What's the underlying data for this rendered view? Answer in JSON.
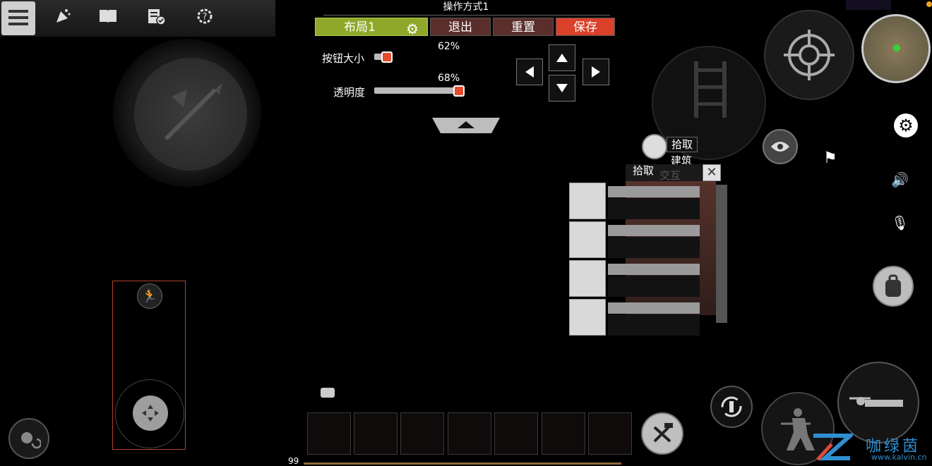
{
  "toolbar": {
    "icons": [
      "menu-icon",
      "party-popper-icon",
      "book-icon",
      "task-list-icon",
      "gear-help-icon"
    ]
  },
  "layout_editor": {
    "title": "操作方式1",
    "layout_tab": "布局1",
    "exit": "退出",
    "reset": "重置",
    "save": "保存",
    "button_size_label": "按钮大小",
    "button_size_pct": "62%",
    "button_size_value": 0.62,
    "opacity_label": "透明度",
    "opacity_pct": "68%",
    "opacity_value": 0.68
  },
  "hud": {
    "pickup_label": "拾取",
    "build_label": "建筑",
    "pickup_list_title": "拾取",
    "interact_label": "交互",
    "hotbar_count": "99",
    "hotbar_slots": 7
  },
  "watermark": {
    "name": "咖绿茵",
    "url": "www.kalvin.cn"
  },
  "colors": {
    "layout_tab": "#8fa82a",
    "save_tab": "#d9412a",
    "brown_tab": "#5a2e2a",
    "joystick_frame": "#b4432c"
  }
}
